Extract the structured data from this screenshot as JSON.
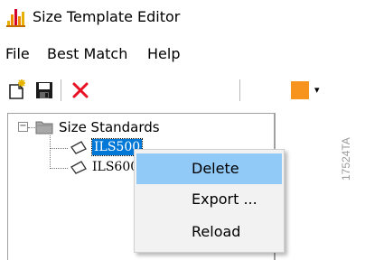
{
  "window": {
    "title": "Size Template Editor",
    "app_icon": "bar-chart-icon"
  },
  "menubar": {
    "items": [
      "File",
      "Best Match",
      "Help"
    ]
  },
  "toolbar": {
    "buttons": [
      "new-document-icon",
      "save-icon",
      "delete-icon"
    ],
    "color_swatch": "#f7941d",
    "dropdown_glyph": "▾"
  },
  "tree": {
    "root": {
      "expander": "−",
      "label": "Size Standards",
      "children": [
        {
          "label": "ILS500",
          "selected": true
        },
        {
          "label": "ILS600",
          "selected": false
        }
      ]
    }
  },
  "context_menu": {
    "items": [
      "Delete",
      "Export ...",
      "Reload"
    ],
    "highlighted": "Delete"
  },
  "figure_id": "17524TA",
  "colors": {
    "selection": "#0078d7",
    "menu_highlight": "#91c9f7",
    "delete_red": "#e81123"
  }
}
